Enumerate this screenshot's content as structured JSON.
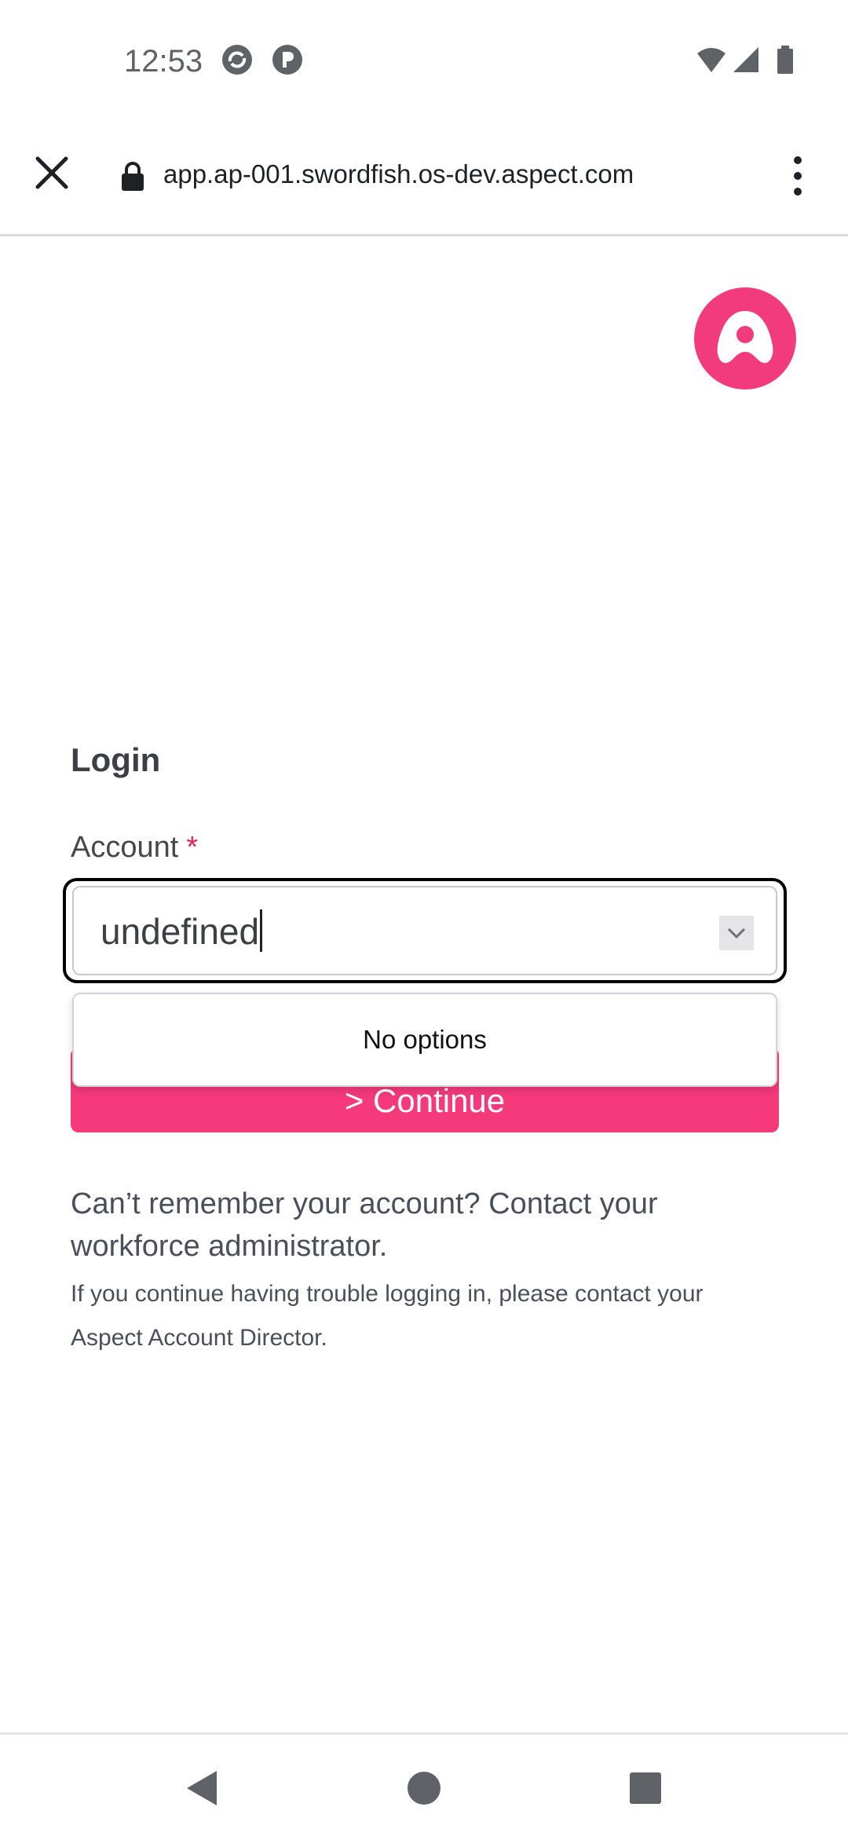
{
  "status_bar": {
    "time": "12:53",
    "icons": [
      "sync-icon",
      "app-notification-icon",
      "wifi-icon",
      "cellular-signal-icon",
      "battery-icon"
    ]
  },
  "browser": {
    "url": "app.ap-001.swordfish.os-dev.aspect.com",
    "icons": [
      "close-icon",
      "lock-icon",
      "more-vert-icon"
    ]
  },
  "brand": {
    "accent": "#f23b7a",
    "logo_icon": "aspect-logo-icon"
  },
  "login": {
    "title": "Login",
    "account_label": "Account",
    "required_marker": "*",
    "account_value": "undefined",
    "dropdown_empty": "No options",
    "continue_label": "> Continue"
  },
  "help": {
    "main": "Can’t remember your account? Contact your workforce administrator.",
    "sub": "If you continue having trouble logging in, please contact your Aspect Account Director."
  },
  "nav_bar": {
    "icons": [
      "back-icon",
      "home-icon",
      "recents-icon"
    ]
  }
}
